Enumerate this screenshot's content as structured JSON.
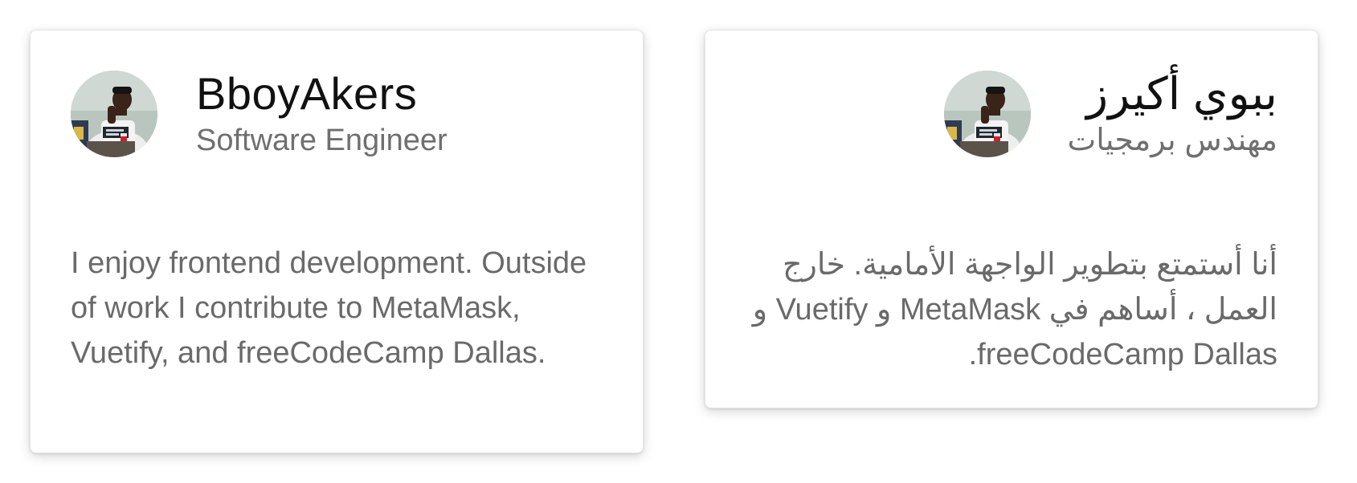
{
  "cards": [
    {
      "name": "BboyAkers",
      "title": "Software Engineer",
      "bio": "I enjoy frontend development. Outside of work I contribute to MetaMask, Vuetify, and freeCodeCamp Dallas."
    },
    {
      "name": "ببوي أكيرز",
      "title": "مهندس برمجيات",
      "bio": "أنا أستمتع بتطوير الواجهة الأمامية. خارج العمل ، أساهم في MetaMask و Vuetify و freeCodeCamp Dallas."
    }
  ]
}
